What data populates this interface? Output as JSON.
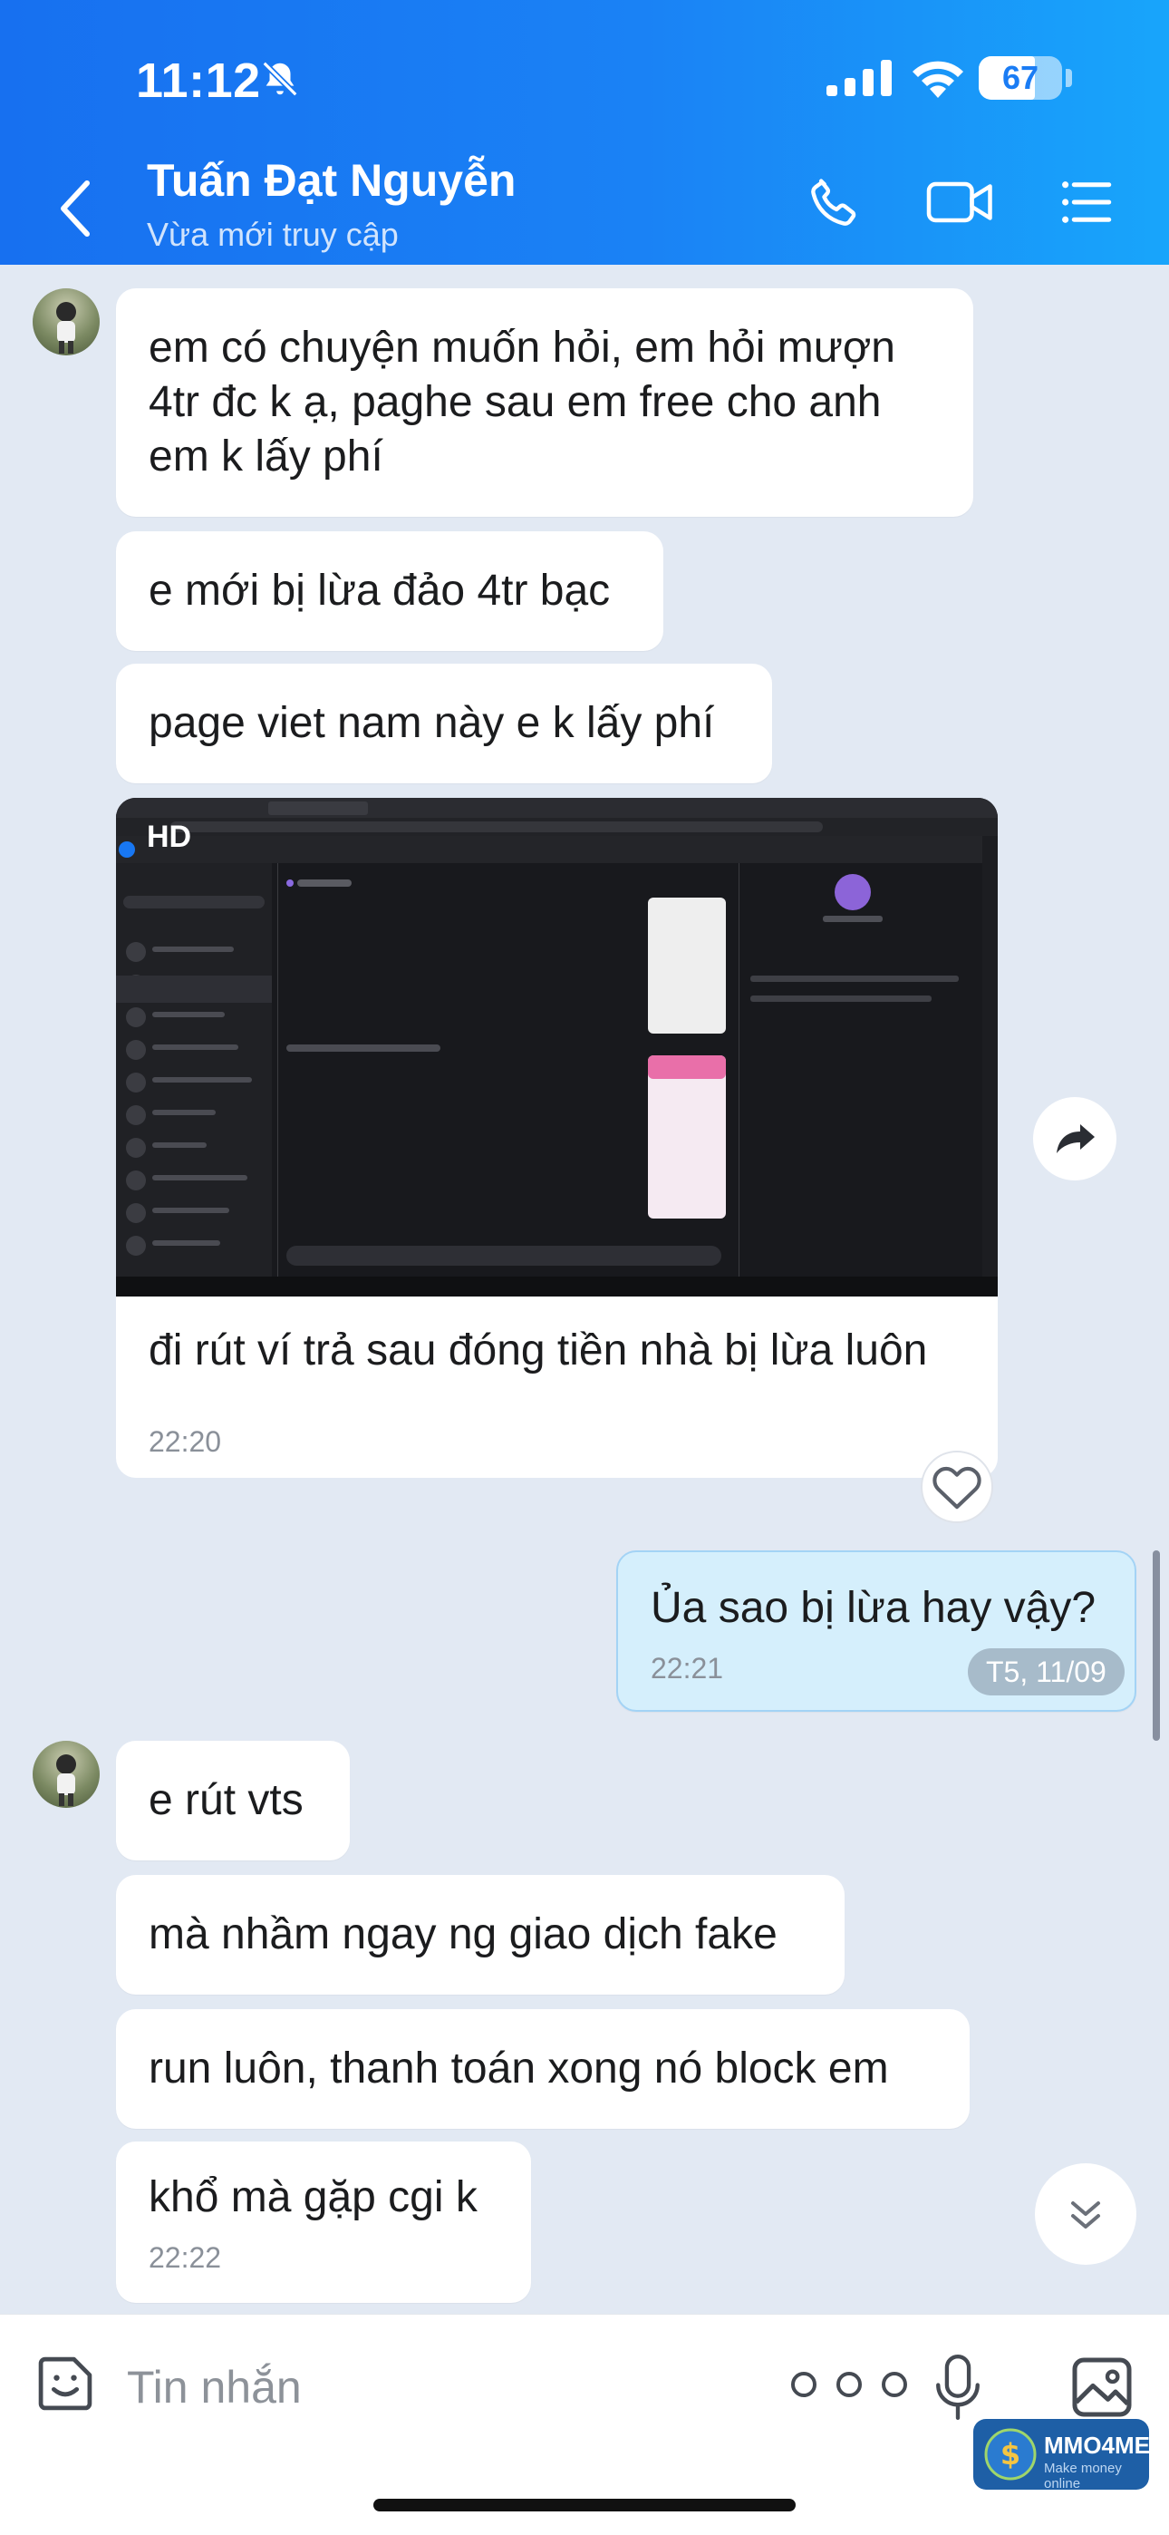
{
  "status_bar": {
    "time": "11:12",
    "battery": "67",
    "battery_level": 0.67
  },
  "header": {
    "name": "Tuấn Đạt Nguyễn",
    "status": "Vừa mới truy cập",
    "icons": [
      "back-chevron-icon",
      "phone-icon",
      "video-camera-icon",
      "menu-list-icon"
    ]
  },
  "messages": [
    {
      "side": "in",
      "text": "em có chuyện muốn hỏi, em hỏi mượn 4tr đc k ạ, paghe sau em free cho anh em k lấy phí"
    },
    {
      "side": "in",
      "text": "e mới bị lừa đảo 4tr bạc"
    },
    {
      "side": "in",
      "text": "page viet nam này e k lấy phí"
    },
    {
      "side": "in",
      "type": "photo",
      "badge": "HD",
      "caption": "đi rút ví trả sau đóng tiền nhà bị lừa luôn",
      "time": "22:20"
    },
    {
      "side": "out",
      "text": "Ủa sao bị lừa hay vậy?",
      "time": "22:21"
    },
    {
      "side": "in",
      "text": "e rút vts"
    },
    {
      "side": "in",
      "text": "mà nhầm ngay ng giao dịch fake"
    },
    {
      "side": "in",
      "text": "run luôn, thanh toán xong nó block em"
    },
    {
      "side": "in",
      "text": "khổ mà gặp cgi k",
      "time": "22:22"
    }
  ],
  "date_pill": "T5, 11/09",
  "composer": {
    "placeholder": "Tin nhắn",
    "more": "ooo"
  },
  "watermark": {
    "title": "MMO4ME",
    "subtitle": "Make money online"
  },
  "colors": {
    "header_start": "#1770f0",
    "header_end": "#18a5fb",
    "outgoing_bubble": "#d5effc",
    "chat_bg": "#e2e9f3"
  }
}
